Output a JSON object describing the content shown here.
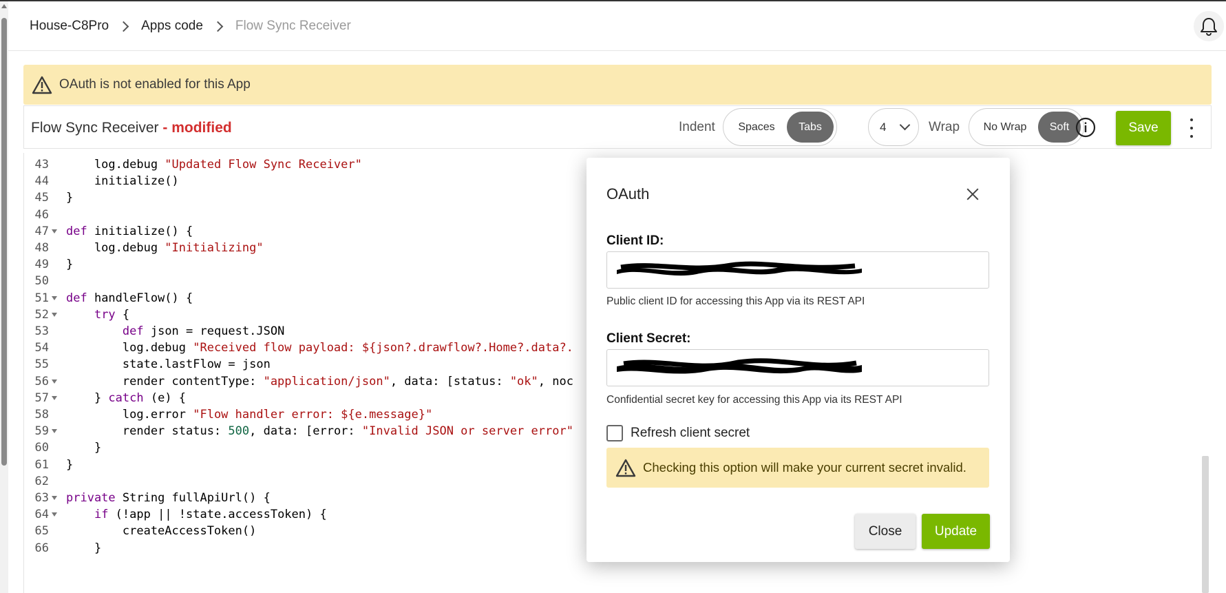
{
  "breadcrumb": {
    "items": [
      "House-C8Pro",
      "Apps code",
      "Flow Sync Receiver"
    ]
  },
  "icons": {
    "notifications": "bell-icon",
    "warning": "warning-triangle-icon",
    "info": "info-circle-icon",
    "more": "kebab-menu-icon",
    "close": "close-icon",
    "select": "chevron-down-icon"
  },
  "banner": {
    "text": "OAuth is not enabled for this App"
  },
  "editor": {
    "file_name": "Flow Sync Receiver",
    "modified_suffix": " - modified",
    "indent_label": "Indent",
    "indent_options": [
      "Spaces",
      "Tabs"
    ],
    "indent_selected": "Tabs",
    "indent_size": "4",
    "wrap_label": "Wrap",
    "wrap_options": [
      "No Wrap",
      "Soft"
    ],
    "wrap_selected": "Soft",
    "save_label": "Save"
  },
  "code": {
    "lines": [
      {
        "n": "43",
        "fold": false,
        "text": "    log.debug \"Updated Flow Sync Receiver\""
      },
      {
        "n": "44",
        "fold": false,
        "text": "    initialize()"
      },
      {
        "n": "45",
        "fold": false,
        "text": "}"
      },
      {
        "n": "46",
        "fold": false,
        "text": ""
      },
      {
        "n": "47",
        "fold": true,
        "text": "def initialize() {"
      },
      {
        "n": "48",
        "fold": false,
        "text": "    log.debug \"Initializing\""
      },
      {
        "n": "49",
        "fold": false,
        "text": "}"
      },
      {
        "n": "50",
        "fold": false,
        "text": ""
      },
      {
        "n": "51",
        "fold": true,
        "text": "def handleFlow() {"
      },
      {
        "n": "52",
        "fold": true,
        "text": "    try {"
      },
      {
        "n": "53",
        "fold": false,
        "text": "        def json = request.JSON"
      },
      {
        "n": "54",
        "fold": false,
        "text": "        log.debug \"Received flow payload: ${json?.drawflow?.Home?.data?."
      },
      {
        "n": "55",
        "fold": false,
        "text": "        state.lastFlow = json"
      },
      {
        "n": "56",
        "fold": true,
        "text": "        render contentType: \"application/json\", data: [status: \"ok\", noc"
      },
      {
        "n": "57",
        "fold": true,
        "text": "    } catch (e) {"
      },
      {
        "n": "58",
        "fold": false,
        "text": "        log.error \"Flow handler error: ${e.message}\""
      },
      {
        "n": "59",
        "fold": true,
        "text": "        render status: 500, data: [error: \"Invalid JSON or server error\""
      },
      {
        "n": "60",
        "fold": false,
        "text": "    }"
      },
      {
        "n": "61",
        "fold": false,
        "text": "}"
      },
      {
        "n": "62",
        "fold": false,
        "text": ""
      },
      {
        "n": "63",
        "fold": true,
        "text": "private String fullApiUrl() {"
      },
      {
        "n": "64",
        "fold": true,
        "text": "    if (!app || !state.accessToken) {"
      },
      {
        "n": "65",
        "fold": false,
        "text": "        createAccessToken()"
      },
      {
        "n": "66",
        "fold": false,
        "text": "    }"
      }
    ]
  },
  "modal": {
    "title": "OAuth",
    "client_id_label": "Client ID:",
    "client_id_help": "Public client ID for accessing this App via its REST API",
    "client_secret_label": "Client Secret:",
    "client_secret_help": "Confidential secret key for accessing this App via its REST API",
    "refresh_label": "Refresh client secret",
    "refresh_checked": false,
    "warning_text": "Checking this option will make your current secret invalid.",
    "close_label": "Close",
    "update_label": "Update"
  },
  "colors": {
    "accent_green": "#7ab800",
    "warning_bg": "#fbeab3",
    "modified_red": "#d32f2f",
    "toggle_active": "#6a6a6a"
  }
}
